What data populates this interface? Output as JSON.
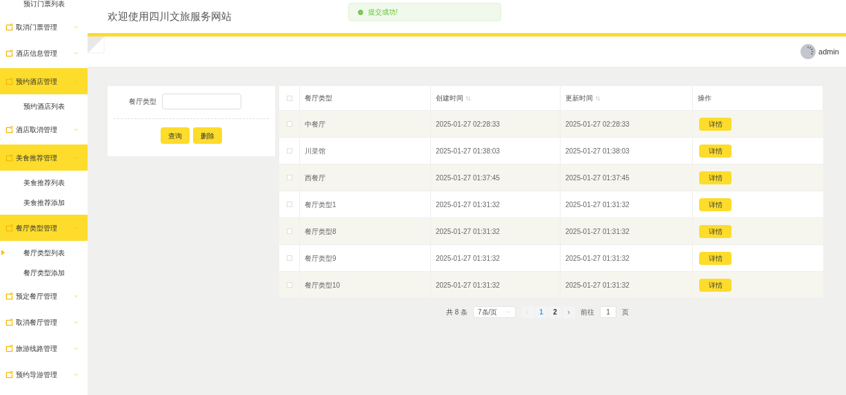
{
  "sidebar": {
    "items": [
      {
        "kind": "link",
        "label": "预订门票列表",
        "selected": false
      },
      {
        "kind": "group",
        "label": "取消门票管理",
        "expanded": false
      },
      {
        "kind": "group",
        "label": "酒店信息管理",
        "expanded": false
      },
      {
        "kind": "group",
        "label": "预约酒店管理",
        "expanded": true,
        "children": [
          {
            "label": "预约酒店列表",
            "selected": false
          }
        ]
      },
      {
        "kind": "group",
        "label": "酒店取消管理",
        "expanded": false
      },
      {
        "kind": "group",
        "label": "美食推荐管理",
        "expanded": true,
        "children": [
          {
            "label": "美食推荐列表",
            "selected": false
          },
          {
            "label": "美食推荐添加",
            "selected": false
          }
        ]
      },
      {
        "kind": "group",
        "label": "餐厅类型管理",
        "expanded": true,
        "children": [
          {
            "label": "餐厅类型列表",
            "selected": true
          },
          {
            "label": "餐厅类型添加",
            "selected": false
          }
        ]
      },
      {
        "kind": "group",
        "label": "预定餐厅管理",
        "expanded": false
      },
      {
        "kind": "group",
        "label": "取消餐厅管理",
        "expanded": false
      },
      {
        "kind": "group",
        "label": "旅游线路管理",
        "expanded": false
      },
      {
        "kind": "group",
        "label": "预约导游管理",
        "expanded": false
      }
    ]
  },
  "header": {
    "title": "欢迎使用四川文旅服务网站",
    "user": "admin"
  },
  "toast": {
    "message": "提交成功!"
  },
  "search": {
    "label": "餐厅类型",
    "buttons": [
      "查询",
      "删除"
    ]
  },
  "table": {
    "all_checked": false,
    "columns": [
      {
        "label": "餐厅类型",
        "sortable": false
      },
      {
        "label": "创建时间",
        "sortable": true
      },
      {
        "label": "更新时间",
        "sortable": true
      },
      {
        "label": "操作",
        "sortable": false
      }
    ],
    "rows": [
      {
        "name": "中餐厅",
        "created": "2025-01-27 02:28:33",
        "updated": "2025-01-27 02:28:33",
        "action": "详情",
        "checked": false
      },
      {
        "name": "川菜馆",
        "created": "2025-01-27 01:38:03",
        "updated": "2025-01-27 01:38:03",
        "action": "详情",
        "checked": false
      },
      {
        "name": "西餐厅",
        "created": "2025-01-27 01:37:45",
        "updated": "2025-01-27 01:37:45",
        "action": "详情",
        "checked": false
      },
      {
        "name": "餐厅类型1",
        "created": "2025-01-27 01:31:32",
        "updated": "2025-01-27 01:31:32",
        "action": "详情",
        "checked": false
      },
      {
        "name": "餐厅类型8",
        "created": "2025-01-27 01:31:32",
        "updated": "2025-01-27 01:31:32",
        "action": "详情",
        "checked": false
      },
      {
        "name": "餐厅类型9",
        "created": "2025-01-27 01:31:32",
        "updated": "2025-01-27 01:31:32",
        "action": "详情",
        "checked": false
      },
      {
        "name": "餐厅类型10",
        "created": "2025-01-27 01:31:32",
        "updated": "2025-01-27 01:31:32",
        "action": "详情",
        "checked": false
      }
    ]
  },
  "pagination": {
    "total": "共 8 条",
    "page_size": "7条/页",
    "pages": [
      {
        "label": "1",
        "selected": true
      },
      {
        "label": "2",
        "selected": false
      }
    ],
    "goto_label": "前往",
    "goto_value": "1",
    "goto_suffix": "页"
  }
}
